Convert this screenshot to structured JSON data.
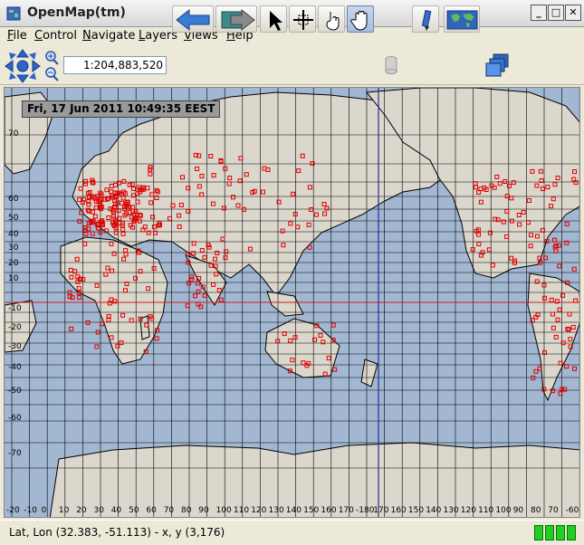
{
  "window": {
    "title": "OpenMap(tm)"
  },
  "menu": [
    {
      "label": "File",
      "mnemonic": "F",
      "rest": "ile"
    },
    {
      "label": "Control",
      "mnemonic": "C",
      "rest": "ontrol"
    },
    {
      "label": "Navigate",
      "mnemonic": "N",
      "rest": "avigate"
    },
    {
      "label": "Layers",
      "mnemonic": "L",
      "rest": "ayers"
    },
    {
      "label": "Views",
      "mnemonic": "V",
      "rest": "iews"
    },
    {
      "label": "Help",
      "mnemonic": "H",
      "rest": "elp"
    }
  ],
  "toolbar": {
    "scale": "1:204,883,520",
    "tools": [
      "pan-arrows-icon",
      "zoom-in-icon",
      "zoom-out-icon",
      "back-arrow-icon",
      "forward-arrow-icon",
      "select-arrow-icon",
      "move-cross-icon",
      "gesture-hand-icon",
      "pan-hand-icon",
      "db-icon",
      "pencil-icon",
      "world-map-icon",
      "layers-icon"
    ]
  },
  "map": {
    "timestamp": "Fri, 17 Jun 2011 10:49:35 EEST",
    "lat_labels": [
      "70",
      "60",
      "50",
      "40",
      "30",
      "20",
      "10",
      "-10",
      "-20",
      "-30",
      "-40",
      "-50",
      "-60",
      "-70"
    ],
    "lon_labels": [
      "-20",
      "-10",
      "0",
      "10",
      "20",
      "30",
      "40",
      "50",
      "60",
      "70",
      "80",
      "90",
      "100",
      "110",
      "120",
      "130",
      "140",
      "150",
      "160",
      "170",
      "-180",
      "170",
      "160",
      "150",
      "140",
      "130",
      "120",
      "110",
      "100",
      "90",
      "80",
      "70",
      "-60"
    ],
    "colors": {
      "ocean": "#a2b7d1",
      "land": "#dbd7cc",
      "grid": "#000000",
      "markers": "#e00000",
      "equator": "#cc2222",
      "meridian": "#2a2a9a"
    }
  },
  "status": {
    "text": "Lat, Lon (32.383, -51.113) - x, y (3,176)"
  }
}
